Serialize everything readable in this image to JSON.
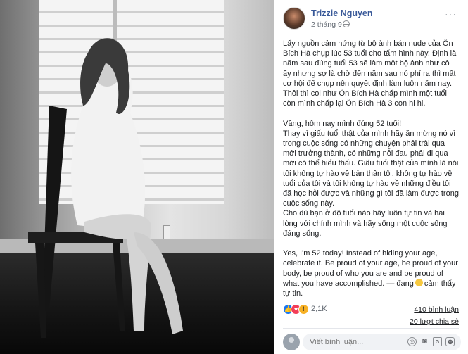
{
  "post": {
    "author": "Trizzie Nguyen",
    "date": "2 tháng 9 ·",
    "more": "···",
    "paragraph1": "Lấy nguồn cảm hứng từ bộ ảnh bán nude của Ôn Bích Hà chụp lúc 53 tuổi cho tấm hình này. Định là năm sau đúng tuổi 53 sẽ làm một bộ ảnh như cô ấy nhưng sợ là chờ đến năm sau nó phí ra thì mất cơ hội để chụp nên quyết định làm luôn năm nay. Thôi thì coi như Ôn Bích Hà chấp mình một tuổi còn mình chấp lại Ôn Bích Hà 3 con hi hi.",
    "paragraph2": "Vâng, hôm nay mình đúng 52 tuổi!",
    "paragraph3": "Thay vì giấu tuổi thật của mình hãy ăn mừng nó vì trong cuộc sống có những chuyện phải trải qua mới trưởng thành, có những nỗi đau phải đi qua mới có thể hiểu thấu. Giấu tuổi thật của mình là nói tôi không tự hào về bản thân tôi, không tự hào về tuổi của tôi và tôi không tự hào về những điều tôi đã học hỏi được và những gì tôi đã làm được trong cuộc sống này.",
    "paragraph4": "Cho dù bạn ở độ tuổi nào hãy luôn tự tin và hài lòng với chính mình và hãy sống một cuộc sống đáng sống.",
    "paragraph5": "Yes, I'm 52 today! Instead of hiding your age, celebrate it. Be proud of your age, be proud of your body, be proud of who you are and be proud of what you have accomplished. — đang",
    "feeling": "cảm thấy tự tin."
  },
  "stats": {
    "reaction_count": "2,1K",
    "comments": "410 bình luận",
    "shares": "20 lượt chia sẻ"
  },
  "comment": {
    "placeholder": "Viết bình luận..."
  },
  "colors": {
    "author_link": "#385898",
    "like": "#1877f2",
    "love": "#f33e58",
    "wow": "#f7b125"
  }
}
